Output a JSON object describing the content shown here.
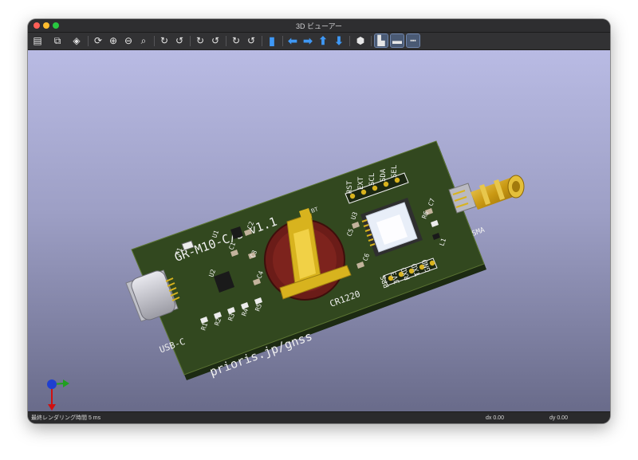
{
  "window": {
    "title": "3D ビューアー"
  },
  "toolbar": {
    "buttons": [
      {
        "name": "render-raytrace-icon",
        "glyph": "▤"
      },
      {
        "name": "copy-image-icon",
        "glyph": "⧉"
      },
      {
        "name": "options-3d-icon",
        "glyph": "◈"
      },
      {
        "name": "reload-icon",
        "glyph": "⟳"
      },
      {
        "name": "zoom-in-icon",
        "glyph": "⊕"
      },
      {
        "name": "zoom-out-icon",
        "glyph": "⊖"
      },
      {
        "name": "zoom-fit-icon",
        "glyph": "⌕"
      },
      {
        "name": "rotate-x-cw-icon",
        "glyph": "↻"
      },
      {
        "name": "rotate-x-ccw-icon",
        "glyph": "↺"
      },
      {
        "name": "rotate-y-cw-icon",
        "glyph": "↻"
      },
      {
        "name": "rotate-y-ccw-icon",
        "glyph": "↺"
      },
      {
        "name": "rotate-z-cw-icon",
        "glyph": "↻"
      },
      {
        "name": "rotate-z-ccw-icon",
        "glyph": "↺"
      },
      {
        "name": "flip-board-icon",
        "glyph": "▮"
      },
      {
        "name": "move-left-icon",
        "glyph": "⬅"
      },
      {
        "name": "move-right-icon",
        "glyph": "➡"
      },
      {
        "name": "move-up-icon",
        "glyph": "⬆"
      },
      {
        "name": "move-down-icon",
        "glyph": "⬇"
      },
      {
        "name": "ortho-toggle-icon",
        "glyph": "⬢"
      },
      {
        "name": "show-th-models-icon",
        "glyph": "▙"
      },
      {
        "name": "show-smd-models-icon",
        "glyph": "▬"
      },
      {
        "name": "show-virtual-models-icon",
        "glyph": "┅"
      }
    ]
  },
  "board": {
    "title_text": "GR-M10-C/S v1.1",
    "url_text": "prioris.jp/gnss",
    "battery_label": "CR1220",
    "usb_label": "USB-C",
    "sma_label": "SMA",
    "top_header_labels": [
      "SEL",
      "SDA",
      "SCL",
      "EXT",
      "RST"
    ],
    "bottom_header_labels": [
      "GND",
      "TXD",
      "RXD",
      "3V3",
      "PPS"
    ],
    "refs": {
      "u1": "U1",
      "u2": "U2",
      "u3": "U3",
      "c1": "C1",
      "c2": "C2",
      "c3": "C3",
      "c4": "C4",
      "c5": "C5",
      "c6": "C6",
      "c7": "C7",
      "f1": "F1",
      "r1": "R1",
      "r2": "R2",
      "r3": "R3",
      "r4": "R4",
      "r5": "R5",
      "r6": "R6",
      "l1": "L1",
      "bt": "BT"
    },
    "colors": {
      "pcb": "#32481f",
      "silk": "#f0f0f0",
      "gold": "#d8b31e",
      "holder": "#6b1c18"
    }
  },
  "status": {
    "render_time": "最終レンダリング時間 5 ms",
    "dx": "dx 0.00",
    "dy": "dy 0.00"
  }
}
